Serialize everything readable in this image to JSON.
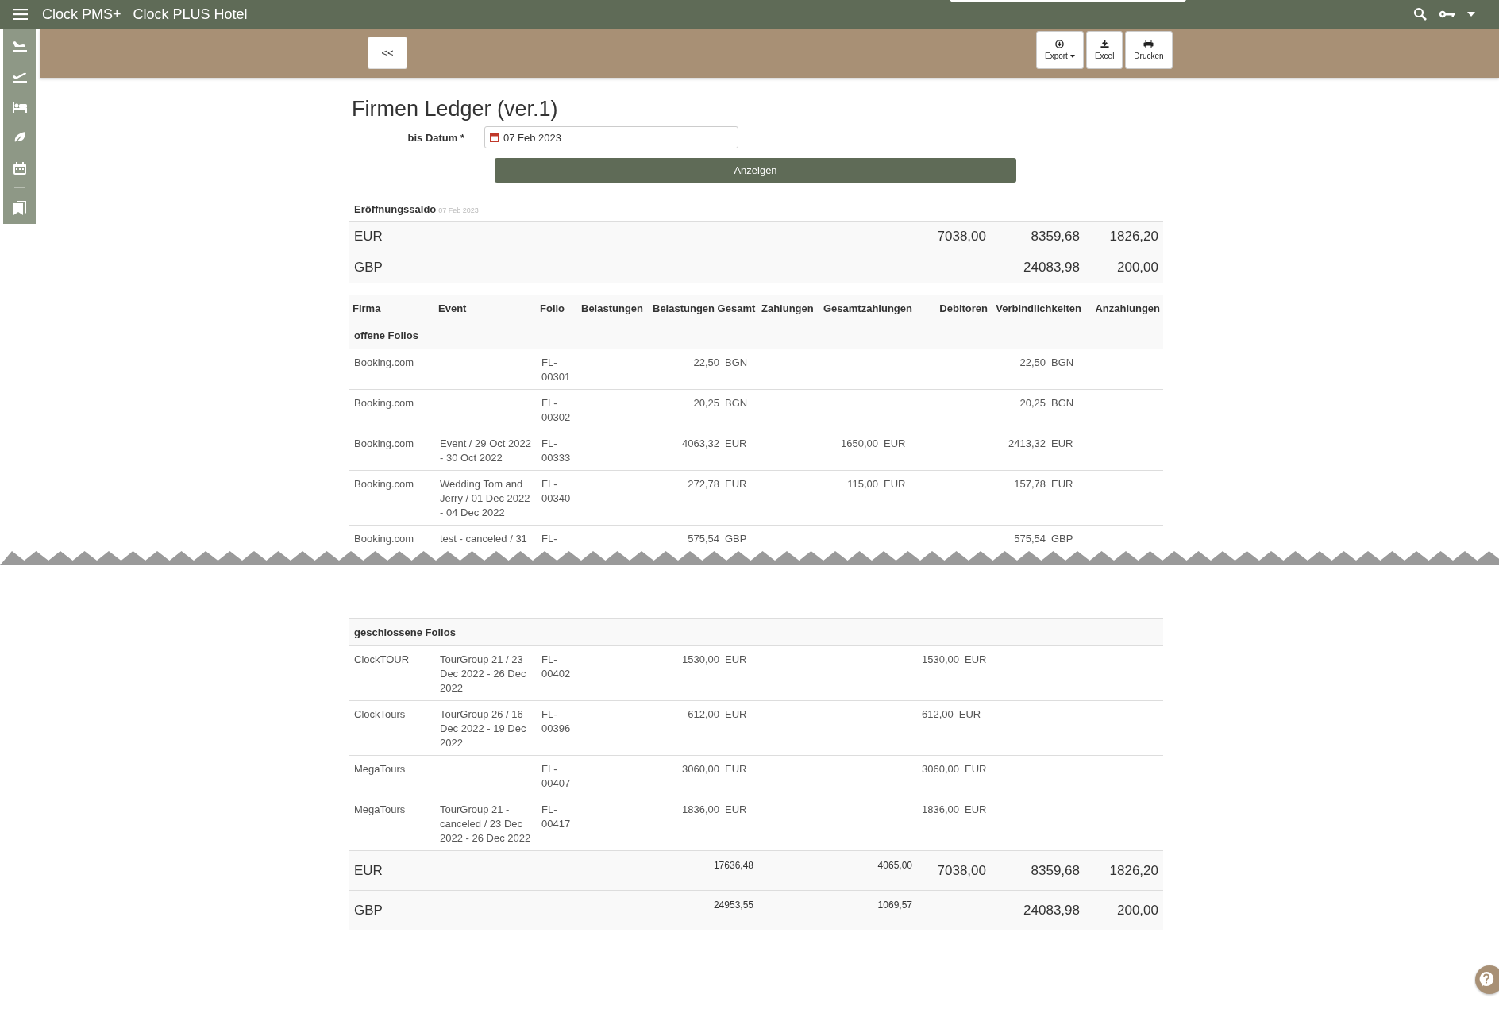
{
  "app": {
    "brand": "Clock PMS+",
    "hotel": "Clock PLUS Hotel"
  },
  "toolbar": {
    "back": "<<",
    "buttons": [
      {
        "kind": "export",
        "label": "Export",
        "dropdown": true
      },
      {
        "kind": "excel",
        "label": "Excel",
        "dropdown": false
      },
      {
        "kind": "print",
        "label": "Drucken",
        "dropdown": false
      }
    ]
  },
  "sidebar": {
    "items": [
      {
        "kind": "arrival"
      },
      {
        "kind": "departure"
      },
      {
        "kind": "bed"
      },
      {
        "kind": "leaf"
      },
      {
        "kind": "calendar"
      },
      {
        "kind": "divider"
      },
      {
        "kind": "bookmarks"
      }
    ]
  },
  "page": {
    "title": "Firmen Ledger (ver.1)",
    "date_label": "bis Datum *",
    "date_value": "07 Feb 2023",
    "submit": "Anzeigen"
  },
  "opening": {
    "label": "Eröffnungssaldo",
    "date": "07 Feb 2023",
    "rows": [
      {
        "currency": "EUR",
        "debitoren": "7038,00",
        "verbindlichkeiten": "8359,68",
        "anzahlungen": "1826,20"
      },
      {
        "currency": "GBP",
        "verbindlichkeiten": "24083,98",
        "anzahlungen": "200,00"
      }
    ]
  },
  "table": {
    "columns": [
      "Firma",
      "Event",
      "Folio",
      "Belastungen",
      "Belastungen Gesamt",
      "Zahlungen",
      "Gesamtzahlungen",
      "Debitoren",
      "Verbindlichkeiten",
      "Anzahlungen"
    ],
    "sections": [
      {
        "title": "offene Folios",
        "cut_off": true,
        "rows": [
          {
            "firma": "Booking.com",
            "folio": "FL-\n00301",
            "belastungen_gesamt": {
              "amount": "22,50",
              "currency": "BGN"
            },
            "verbindlichkeiten": {
              "amount": "22,50",
              "currency": "BGN"
            }
          },
          {
            "firma": "Booking.com",
            "folio": "FL-\n00302",
            "belastungen_gesamt": {
              "amount": "20,25",
              "currency": "BGN"
            },
            "verbindlichkeiten": {
              "amount": "20,25",
              "currency": "BGN"
            }
          },
          {
            "firma": "Booking.com",
            "event": "Event / 29 Oct 2022 - 30 Oct 2022",
            "folio": "FL-\n00333",
            "belastungen_gesamt": {
              "amount": "4063,32",
              "currency": "EUR"
            },
            "gesamtzahlungen": {
              "amount": "1650,00",
              "currency": "EUR"
            },
            "verbindlichkeiten": {
              "amount": "2413,32",
              "currency": "EUR"
            }
          },
          {
            "firma": "Booking.com",
            "event": "Wedding Tom and Jerry / 01 Dec 2022 - 04 Dec 2022",
            "folio": "FL-\n00340",
            "belastungen_gesamt": {
              "amount": "272,78",
              "currency": "EUR"
            },
            "gesamtzahlungen": {
              "amount": "115,00",
              "currency": "EUR"
            },
            "verbindlichkeiten": {
              "amount": "157,78",
              "currency": "EUR"
            }
          },
          {
            "firma": "Booking.com",
            "event": "test - canceled / 31",
            "folio": "FL-",
            "belastungen_gesamt": {
              "amount": "575,54",
              "currency": "GBP"
            },
            "verbindlichkeiten": {
              "amount": "575,54",
              "currency": "GBP"
            }
          }
        ]
      },
      {
        "title": "geschlossene Folios",
        "cut_off": false,
        "rows": [
          {
            "firma": "ClockTOUR",
            "event": "TourGroup 21 / 23 Dec 2022 - 26 Dec 2022",
            "folio": "FL-\n00402",
            "belastungen_gesamt": {
              "amount": "1530,00",
              "currency": "EUR"
            },
            "debitoren": {
              "amount": "1530,00",
              "currency": "EUR"
            }
          },
          {
            "firma": "ClockTours",
            "event": "TourGroup 26 / 16 Dec 2022 - 19 Dec 2022",
            "folio": "FL-\n00396",
            "belastungen_gesamt": {
              "amount": "612,00",
              "currency": "EUR"
            },
            "debitoren": {
              "amount": "612,00",
              "currency": "EUR"
            }
          },
          {
            "firma": "MegaTours",
            "folio": "FL-\n00407",
            "belastungen_gesamt": {
              "amount": "3060,00",
              "currency": "EUR"
            },
            "debitoren": {
              "amount": "3060,00",
              "currency": "EUR"
            }
          },
          {
            "firma": "MegaTours",
            "event": "TourGroup 21 - canceled / 23 Dec 2022 - 26 Dec 2022",
            "folio": "FL-\n00417",
            "belastungen_gesamt": {
              "amount": "1836,00",
              "currency": "EUR"
            },
            "debitoren": {
              "amount": "1836,00",
              "currency": "EUR"
            }
          }
        ]
      }
    ],
    "totals": [
      {
        "currency": "EUR",
        "belastungen_gesamt": "17636,48",
        "gesamtzahlungen": "4065,00",
        "debitoren": "7038,00",
        "verbindlichkeiten": "8359,68",
        "anzahlungen": "1826,20"
      },
      {
        "currency": "GBP",
        "belastungen_gesamt": "24953,55",
        "gesamtzahlungen": "1069,57",
        "verbindlichkeiten": "24083,98",
        "anzahlungen": "200,00"
      }
    ]
  }
}
